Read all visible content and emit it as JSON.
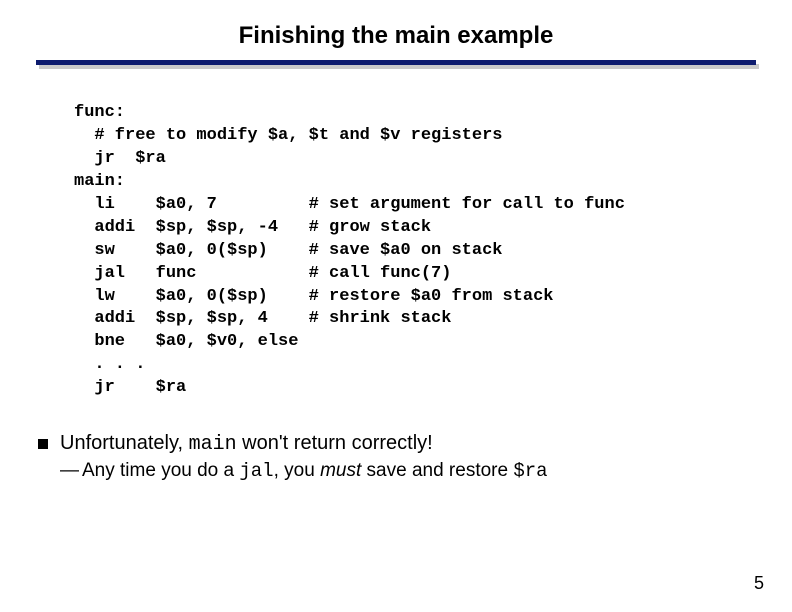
{
  "title": "Finishing the main example",
  "code": "func:\n  # free to modify $a, $t and $v registers\n  jr  $ra\nmain:\n  li    $a0, 7         # set argument for call to func\n  addi  $sp, $sp, -4   # grow stack\n  sw    $a0, 0($sp)    # save $a0 on stack\n  jal   func           # call func(7)\n  lw    $a0, 0($sp)    # restore $a0 from stack\n  addi  $sp, $sp, 4    # shrink stack\n  bne   $a0, $v0, else\n  . . .\n  jr    $ra",
  "bullets": {
    "b1_pre": "Unfortunately, ",
    "b1_code": "main",
    "b1_post": " won't return correctly!",
    "b2_pre": "Any time you do a ",
    "b2_code": "jal",
    "b2_mid": ", you ",
    "b2_ital": "must",
    "b2_post": " save and restore ",
    "b2_code2": "$ra"
  },
  "page_number": "5"
}
